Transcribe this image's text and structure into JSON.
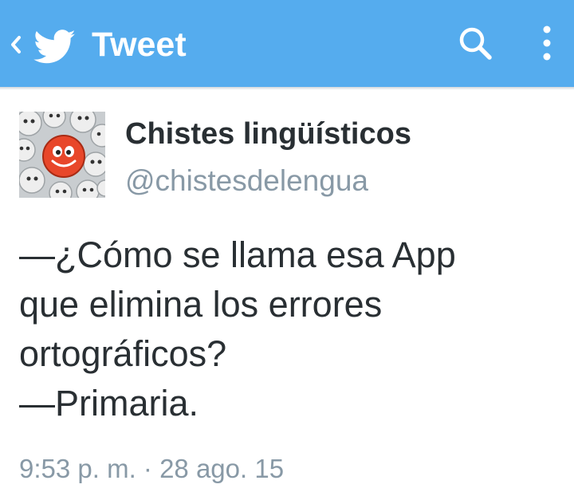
{
  "colors": {
    "appbar": "#55acee",
    "appbar_text": "#ffffff",
    "name_text": "#292f33",
    "secondary_text": "#8899a6"
  },
  "appbar": {
    "back_icon": "chevron-left-icon",
    "logo_icon": "twitter-bird-icon",
    "title": "Tweet",
    "search_icon": "search-icon",
    "more_icon": "more-vertical-icon"
  },
  "tweet": {
    "avatar_icon": "emoji-faces-avatar",
    "display_name": "Chistes lingüísticos",
    "handle": "@chistesdelengua",
    "text_lines": [
      "—¿Cómo se llama esa App",
      "que elimina los errores",
      "ortográficos?",
      "—Primaria."
    ],
    "timestamp": "9:53 p. m. · 28 ago. 15"
  }
}
